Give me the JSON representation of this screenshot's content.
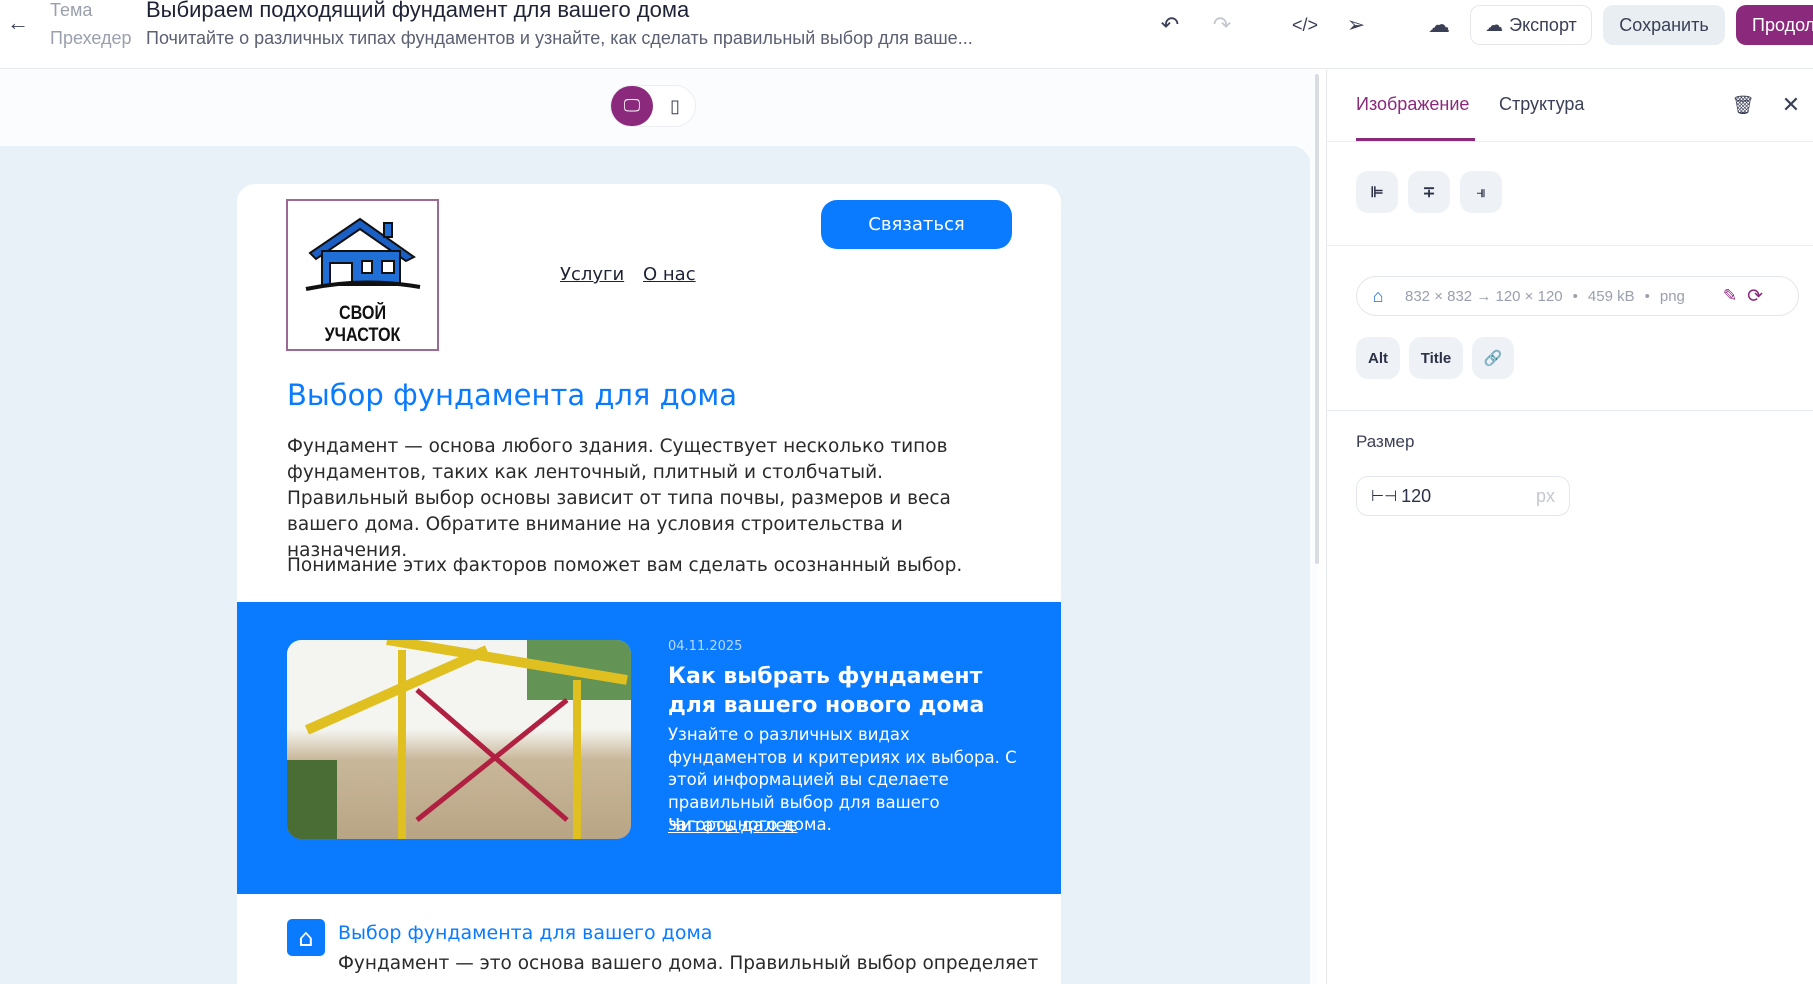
{
  "header": {
    "back_icon": "arrow-left-icon",
    "subject_label": "Тема",
    "subject": "Выбираем подходящий фундамент для вашего дома",
    "preheader_label": "Прехедер",
    "preheader": "Почитайте о различных типах фундаментов и узнайте, как сделать правильный выбор для ваше...",
    "export": "Экспорт",
    "save": "Сохранить",
    "continue": "Продол"
  },
  "email": {
    "logo_text": "СВОЙ УЧАСТОК",
    "contact_button": "Связаться",
    "nav": [
      "Услуги",
      "О нас"
    ],
    "title": "Выбор фундамента для дома",
    "paragraph1": "Фундамент — основа любого здания. Существует несколько типов фундаментов, таких как ленточный, плитный и столбчатый. Правильный выбор основы зависит от типа почвы, размеров и веса вашего дома. Обратите внимание на условия строительства и назначения.",
    "paragraph2": "Понимание этих факторов поможет вам сделать осознанный выбор.",
    "article": {
      "date": "04.11.2025",
      "title": "Как выбрать фундамент для вашего нового дома",
      "text": "Узнайте о различных видах фундаментов и критериях их выбора. С этой информацией вы сделаете правильный выбор для вашего загородного дома.",
      "link": "Читать далее"
    },
    "feature": {
      "title": "Выбор фундамента для вашего дома",
      "text": "Фундамент — это основа вашего дома. Правильный выбор определяет"
    }
  },
  "panel": {
    "tabs": [
      "Изображение",
      "Структура"
    ],
    "image_info": {
      "dimensions": "832 × 832 → 120 × 120",
      "size": "459 kB",
      "format": "png"
    },
    "alt": "Alt",
    "title": "Title",
    "size_label": "Размер",
    "width_value": "120",
    "unit": "px"
  },
  "colors": {
    "accent": "#8b2a7d",
    "email_blue": "#0a7bff"
  }
}
